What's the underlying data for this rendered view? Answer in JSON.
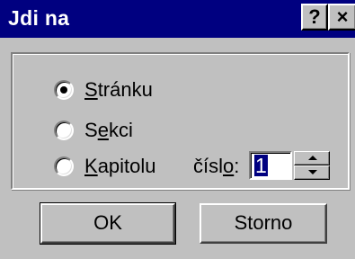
{
  "dialog": {
    "title": "Jdi na",
    "help_button": "?",
    "close_button": "×"
  },
  "options": [
    {
      "pre": "",
      "mnemonic": "S",
      "post": "tránku",
      "selected": true
    },
    {
      "pre": "S",
      "mnemonic": "e",
      "post": "kci",
      "selected": false
    },
    {
      "pre": "",
      "mnemonic": "K",
      "post": "apitolu",
      "selected": false
    }
  ],
  "number": {
    "label_pre": "čísl",
    "label_mnemonic": "o",
    "label_post": ":",
    "value": "1"
  },
  "buttons": {
    "ok": "OK",
    "cancel": "Storno"
  },
  "colors": {
    "title_bar": "#000080",
    "dialog_face": "#c0c0c0",
    "selection": "#000080"
  }
}
